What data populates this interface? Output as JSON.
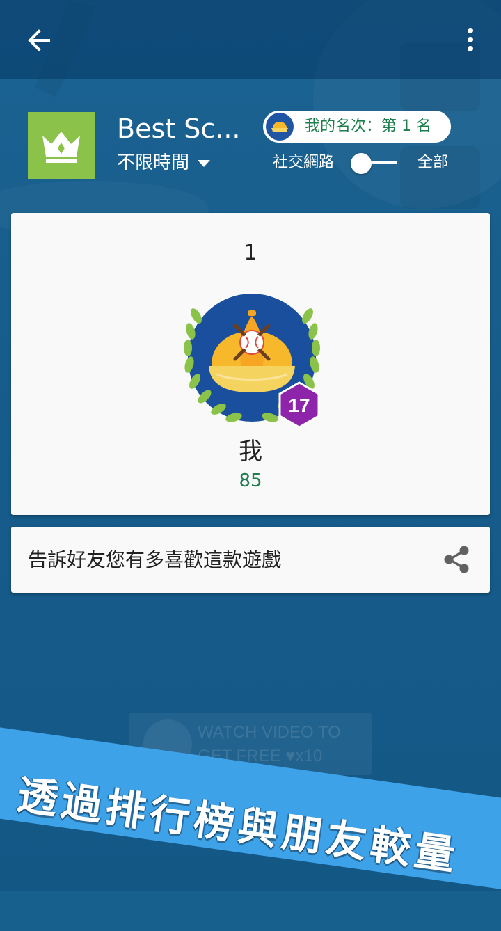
{
  "header": {
    "back_icon": "arrow-left-icon",
    "more_icon": "more-vertical-icon"
  },
  "leaderboard": {
    "title": "Best Sc...",
    "time_filter": "不限時間",
    "my_rank": "我的名次：第 1 名",
    "social_label": "社交網路",
    "all_label": "全部",
    "toggle_state": "social"
  },
  "entries": [
    {
      "rank": "1",
      "name": "我",
      "score": "85",
      "level": "17"
    }
  ],
  "share": {
    "text": "告訴好友您有多喜歡這款遊戲",
    "icon": "share-icon"
  },
  "watch_video": {
    "line1": "WATCH VIDEO TO",
    "line2": "GET FREE",
    "count": "x10"
  },
  "promo": {
    "text": "透過排行榜與朋友較量"
  },
  "colors": {
    "background": "#175f8c",
    "appbar": "#0a3f6b",
    "game_icon": "#8bc34a",
    "score_green": "#1e7d4d",
    "level_badge": "#8e24aa",
    "promo_banner": "#3ea2e8",
    "card": "#f9f9f9"
  }
}
